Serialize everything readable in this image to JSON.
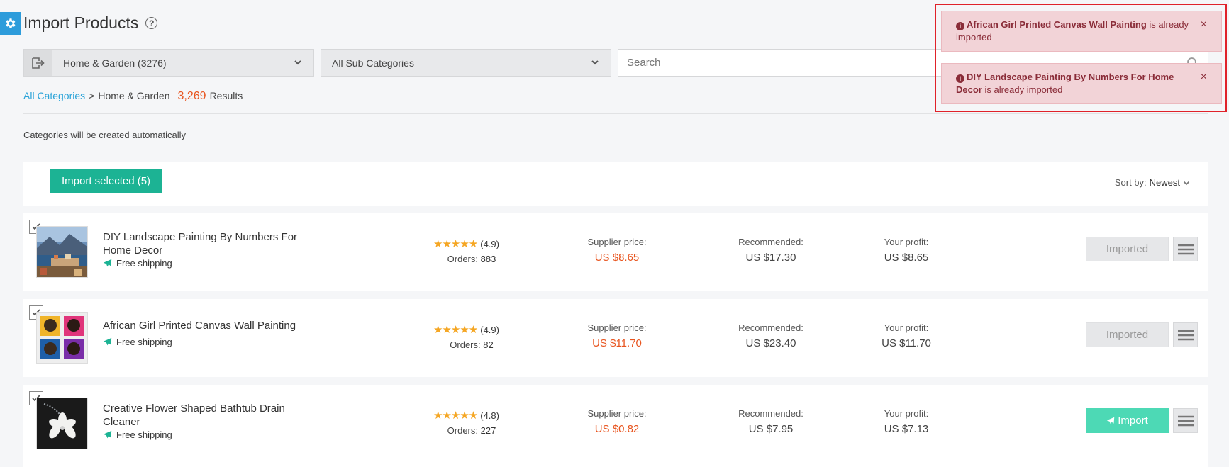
{
  "header": {
    "title": "Import Products"
  },
  "filters": {
    "category": "Home & Garden (3276)",
    "subcategory": "All Sub Categories",
    "search_placeholder": "Search"
  },
  "breadcrumb": {
    "root": "All Categories",
    "sep": ">",
    "current": "Home & Garden",
    "count": "3,269",
    "results_label": "Results"
  },
  "note": "Categories will be created automatically",
  "toolbar": {
    "import_selected": "Import selected (5)",
    "sort_label": "Sort by:",
    "sort_value": "Newest"
  },
  "products": [
    {
      "name": "DIY Landscape Painting By Numbers For Home Decor",
      "shipping": "Free shipping",
      "rating": "(4.9)",
      "orders_label": "Orders:",
      "orders": "883",
      "supplier_label": "Supplier price:",
      "supplier": "US $8.65",
      "rec_label": "Recommended:",
      "recommended": "US $17.30",
      "profit_label": "Your profit:",
      "profit": "US $8.65",
      "action": "Imported",
      "checked": true
    },
    {
      "name": "African Girl Printed Canvas Wall Painting",
      "shipping": "Free shipping",
      "rating": "(4.9)",
      "orders_label": "Orders:",
      "orders": "82",
      "supplier_label": "Supplier price:",
      "supplier": "US $11.70",
      "rec_label": "Recommended:",
      "recommended": "US $23.40",
      "profit_label": "Your profit:",
      "profit": "US $11.70",
      "action": "Imported",
      "checked": true
    },
    {
      "name": "Creative Flower Shaped Bathtub Drain Cleaner",
      "shipping": "Free shipping",
      "rating": "(4.8)",
      "orders_label": "Orders:",
      "orders": "227",
      "supplier_label": "Supplier price:",
      "supplier": "US $0.82",
      "rec_label": "Recommended:",
      "recommended": "US $7.95",
      "profit_label": "Your profit:",
      "profit": "US $7.13",
      "action": "Import",
      "checked": true
    }
  ],
  "toasts": [
    {
      "title": "African Girl Printed Canvas Wall Painting",
      "message": "is already imported"
    },
    {
      "title": "DIY Landscape Painting By Numbers For Home Decor",
      "message": "is already imported"
    }
  ],
  "icons": {
    "stars": "★★★★★",
    "close": "×"
  },
  "colors": {
    "accent": "#1cb394",
    "import_button": "#4dd9b5",
    "price": "#e8541e",
    "link": "#2aa3d8",
    "toast_bg": "#f2d3d7",
    "toast_text": "#8a2c38",
    "highlight_border": "#e0222a"
  }
}
